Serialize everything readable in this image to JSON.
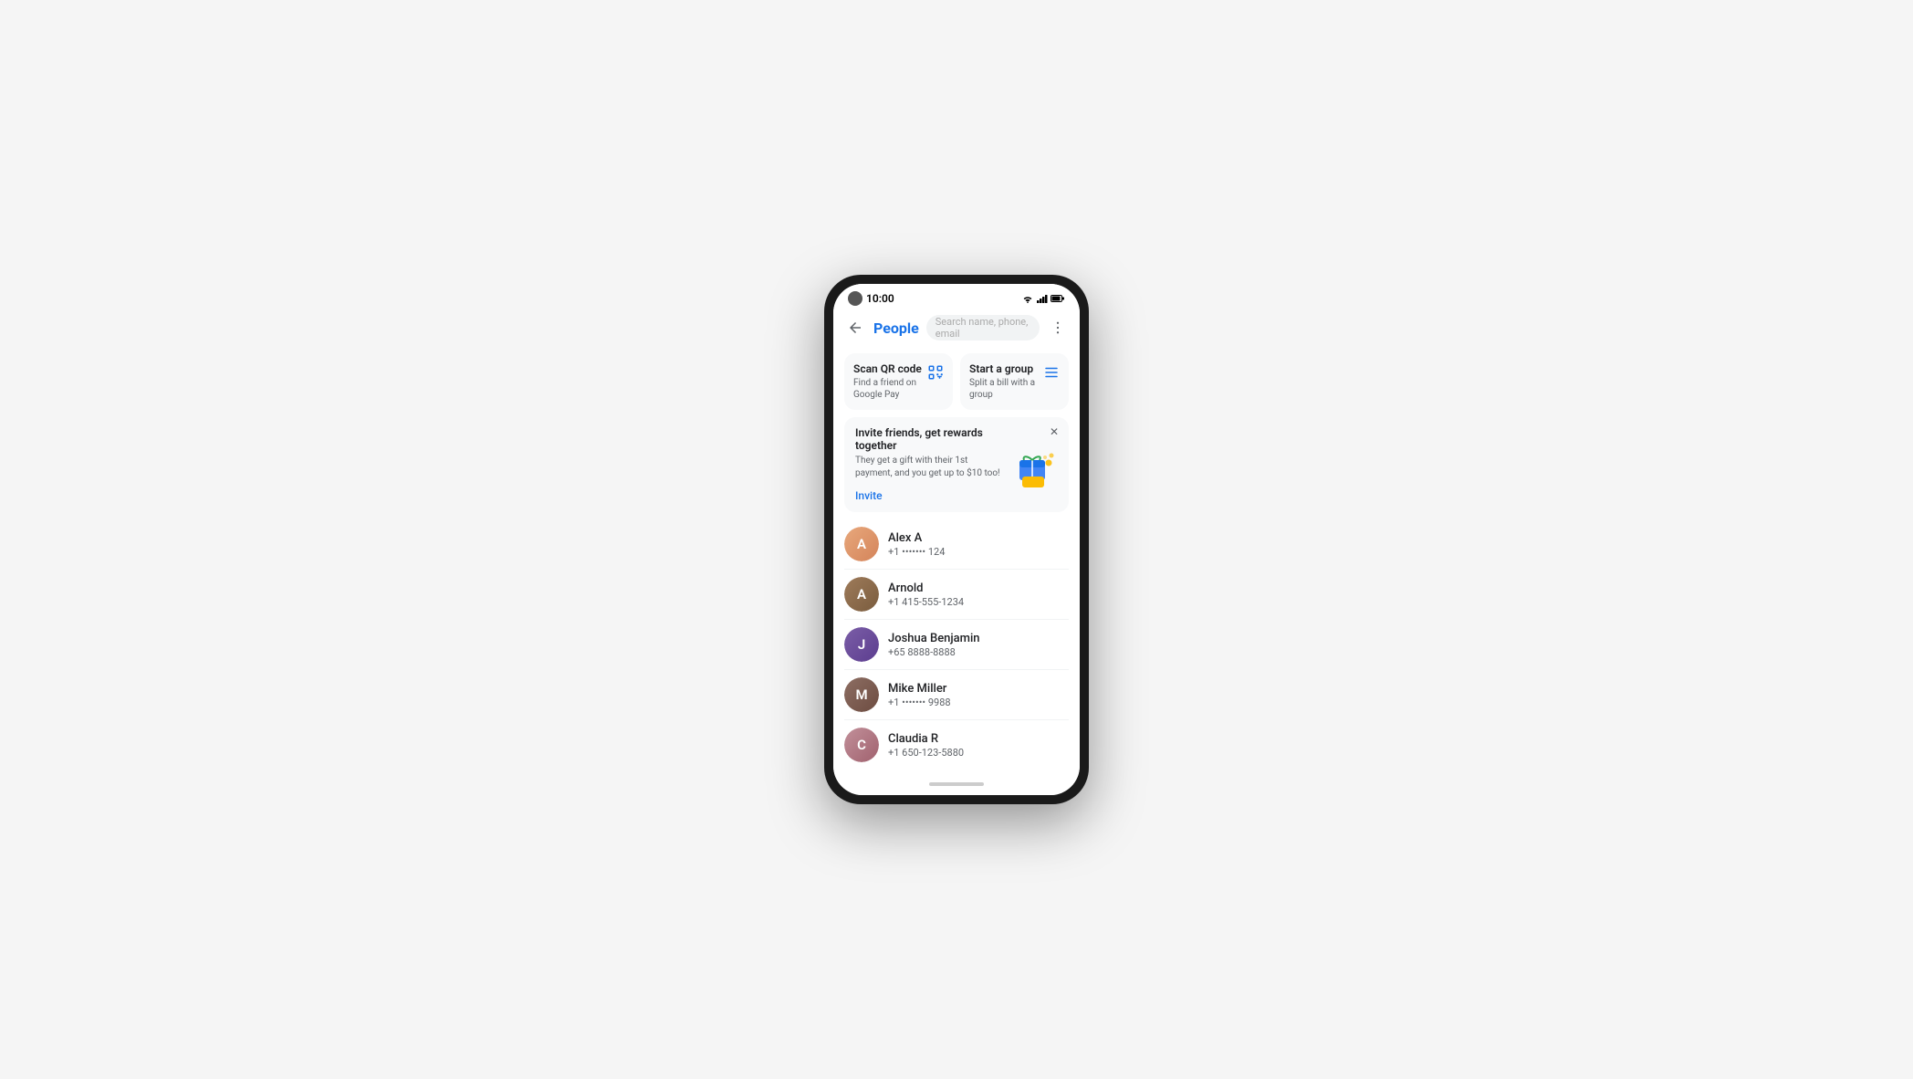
{
  "phone": {
    "status_bar": {
      "time": "10:00"
    },
    "top_bar": {
      "page_title": "People",
      "search_placeholder": "Search name, phone, email"
    },
    "action_cards": [
      {
        "id": "scan-qr",
        "title": "Scan QR code",
        "subtitle": "Find a friend on Google Pay",
        "icon": "qr"
      },
      {
        "id": "start-group",
        "title": "Start a group",
        "subtitle": "Split a bill with a group",
        "icon": "list"
      }
    ],
    "invite_banner": {
      "title": "Invite friends, get rewards together",
      "subtitle": "They get a gift with their 1st payment, and you get up to $10 too!",
      "link_label": "Invite"
    },
    "contacts": [
      {
        "id": "alex-a",
        "name": "Alex A",
        "phone": "+1 ••••••• 124",
        "avatar_letter": "A",
        "avatar_color": "orange"
      },
      {
        "id": "arnold",
        "name": "Arnold",
        "phone": "+1 415-555-1234",
        "avatar_letter": "A",
        "avatar_color": "brown"
      },
      {
        "id": "joshua-benjamin",
        "name": "Joshua Benjamin",
        "phone": "+65 8888-8888",
        "avatar_letter": "J",
        "avatar_color": "purple"
      },
      {
        "id": "mike-miller",
        "name": "Mike Miller",
        "phone": "+1 ••••••• 9988",
        "avatar_letter": "M",
        "avatar_color": "brown2"
      },
      {
        "id": "claudia-r",
        "name": "Claudia R",
        "phone": "+1 650-123-5880",
        "avatar_letter": "C",
        "avatar_color": "pink"
      }
    ],
    "home_indicator": true
  }
}
